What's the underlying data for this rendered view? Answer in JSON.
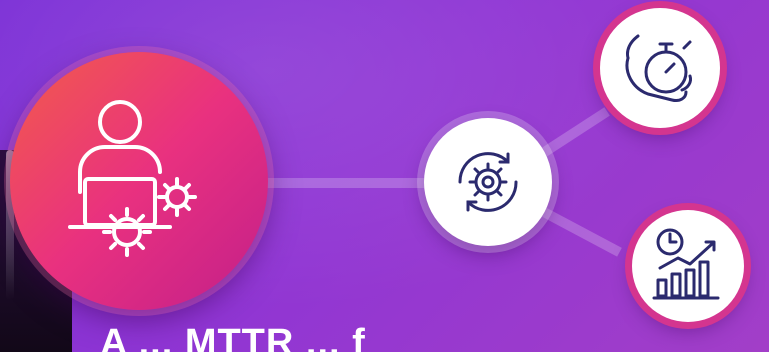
{
  "caption": {
    "text": "A ... MTTR ... f"
  },
  "icons": {
    "hub": "user-with-laptop-and-gears-icon",
    "center": "gear-cycle-icon",
    "top_right": "stopwatch-in-hand-icon",
    "bottom_right": "clock-growth-chart-icon"
  },
  "colors": {
    "background": "#8f35d4",
    "hub_start": "#f25c4a",
    "hub_end": "#c21f8a",
    "ring_accent": "#d4358f",
    "icon_stroke": "#2b2a6e"
  }
}
